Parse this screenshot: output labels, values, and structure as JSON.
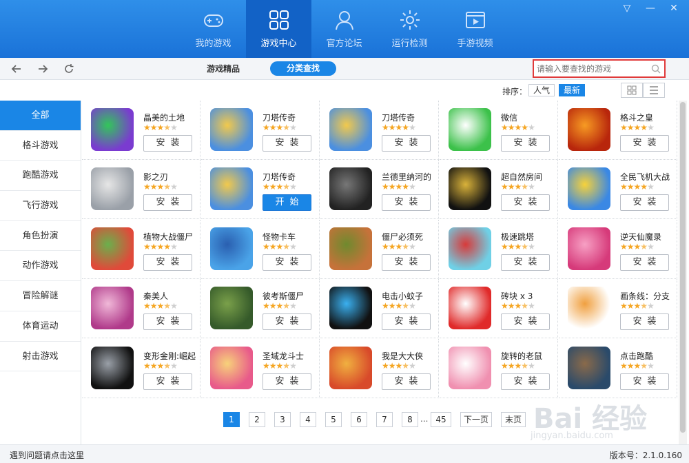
{
  "window_controls": [
    "▽",
    "—",
    "✕"
  ],
  "nav": [
    {
      "label": "我的游戏",
      "icon": "gamepad-icon",
      "active": false
    },
    {
      "label": "游戏中心",
      "icon": "grid-icon",
      "active": true
    },
    {
      "label": "官方论坛",
      "icon": "user-icon",
      "active": false
    },
    {
      "label": "运行检测",
      "icon": "gear-icon",
      "active": false
    },
    {
      "label": "手游视频",
      "icon": "video-icon",
      "active": false
    }
  ],
  "toolbar": {
    "subtab_featured": "游戏精品",
    "subtab_category": "分类查找",
    "search_placeholder": "请输入要查找的游戏"
  },
  "sort": {
    "label": "排序：",
    "popular": "人气",
    "newest": "最新",
    "active": "最新"
  },
  "sidebar": [
    {
      "label": "全部",
      "active": true
    },
    {
      "label": "格斗游戏"
    },
    {
      "label": "跑酷游戏"
    },
    {
      "label": "飞行游戏"
    },
    {
      "label": "角色扮演"
    },
    {
      "label": "动作游戏"
    },
    {
      "label": "冒险解谜"
    },
    {
      "label": "体育运动"
    },
    {
      "label": "射击游戏"
    }
  ],
  "install_label": "安装",
  "start_label": "开始",
  "apps": [
    {
      "name": "晶美的土地",
      "rating": 3.5,
      "button": "install",
      "colors": [
        "#7a3bd0",
        "#32c65a"
      ]
    },
    {
      "name": "刀塔传奇",
      "rating": 3.5,
      "button": "install",
      "colors": [
        "#4b8fe0",
        "#f2c94c"
      ]
    },
    {
      "name": "刀塔传奇",
      "rating": 4,
      "button": "install",
      "colors": [
        "#4b8fe0",
        "#f2c94c"
      ]
    },
    {
      "name": "微信",
      "rating": 4,
      "button": "install",
      "colors": [
        "#3cc14a",
        "#ffffff"
      ]
    },
    {
      "name": "格斗之皇",
      "rating": 4,
      "button": "install",
      "colors": [
        "#b8260c",
        "#f79b23"
      ]
    },
    {
      "name": "影之刃",
      "rating": 3.5,
      "button": "install",
      "colors": [
        "#9aa0a8",
        "#e6e6e6"
      ]
    },
    {
      "name": "刀塔传奇",
      "rating": 3.5,
      "button": "start",
      "colors": [
        "#4b8fe0",
        "#f2c94c"
      ]
    },
    {
      "name": "兰德里纳河的",
      "rating": 4,
      "button": "install",
      "colors": [
        "#222222",
        "#777777"
      ]
    },
    {
      "name": "超自然房间",
      "rating": 3.5,
      "button": "install",
      "colors": [
        "#111111",
        "#d9b23a"
      ]
    },
    {
      "name": "全民飞机大战",
      "rating": 4,
      "button": "install",
      "colors": [
        "#3a88e4",
        "#f7d23a"
      ]
    },
    {
      "name": "植物大战僵尸",
      "rating": 4,
      "button": "install",
      "colors": [
        "#e04a3a",
        "#6ab04c"
      ]
    },
    {
      "name": "怪物卡车",
      "rating": 3.5,
      "button": "install",
      "colors": [
        "#4aa3e8",
        "#2a5fb0"
      ]
    },
    {
      "name": "僵尸必须死",
      "rating": 3.5,
      "button": "install",
      "colors": [
        "#c6723a",
        "#6f8a2e"
      ]
    },
    {
      "name": "极速跳塔",
      "rating": 3.5,
      "button": "install",
      "colors": [
        "#6fd0e6",
        "#d83a3a"
      ]
    },
    {
      "name": "逆天仙魔录",
      "rating": 3.5,
      "button": "install",
      "colors": [
        "#d63a7a",
        "#f7a0c4"
      ]
    },
    {
      "name": "秦美人",
      "rating": 3.5,
      "button": "install",
      "colors": [
        "#b03a8a",
        "#f0b8d8"
      ]
    },
    {
      "name": "彼考斯僵尸",
      "rating": 3.5,
      "button": "install",
      "colors": [
        "#355a2a",
        "#7aa04a"
      ]
    },
    {
      "name": "电击小蚊子",
      "rating": 3.5,
      "button": "install",
      "colors": [
        "#111111",
        "#3ab0f0"
      ]
    },
    {
      "name": "砖块 x 3",
      "rating": 3.5,
      "button": "install",
      "colors": [
        "#e02a2a",
        "#ffffff"
      ]
    },
    {
      "name": "画条线：分支",
      "rating": 3.5,
      "button": "install",
      "colors": [
        "#ffffff",
        "#f0a040"
      ]
    },
    {
      "name": "变形金刚:崛起",
      "rating": 3.5,
      "button": "install",
      "colors": [
        "#111111",
        "#9aa0a8"
      ]
    },
    {
      "name": "圣域龙斗士",
      "rating": 3.5,
      "button": "install",
      "colors": [
        "#e85a8a",
        "#f7d27a"
      ]
    },
    {
      "name": "我是大大侠",
      "rating": 3.5,
      "button": "install",
      "colors": [
        "#d84a2a",
        "#f0b040"
      ]
    },
    {
      "name": "旋转的老鼠",
      "rating": 3.5,
      "button": "install",
      "colors": [
        "#f090b0",
        "#ffffff"
      ]
    },
    {
      "name": "点击跑酷",
      "rating": 3.5,
      "button": "install",
      "colors": [
        "#2a4a6a",
        "#8a6a4a"
      ]
    }
  ],
  "pager": {
    "pages": [
      "1",
      "2",
      "3",
      "4",
      "5",
      "6",
      "7",
      "8"
    ],
    "current": "1",
    "ellipsis": "...",
    "last": "45",
    "next": "下一页",
    "end": "末页"
  },
  "status": {
    "help": "遇到问题请点击这里",
    "version": "版本号：2.1.0.160"
  },
  "watermark": {
    "brand": "Bai 经验",
    "url": "jingyan.baidu.com"
  },
  "colors": {
    "accent": "#1a86e6",
    "header": "#1f7ddf",
    "star": "#f5a623",
    "search_border": "#e03a3a"
  }
}
